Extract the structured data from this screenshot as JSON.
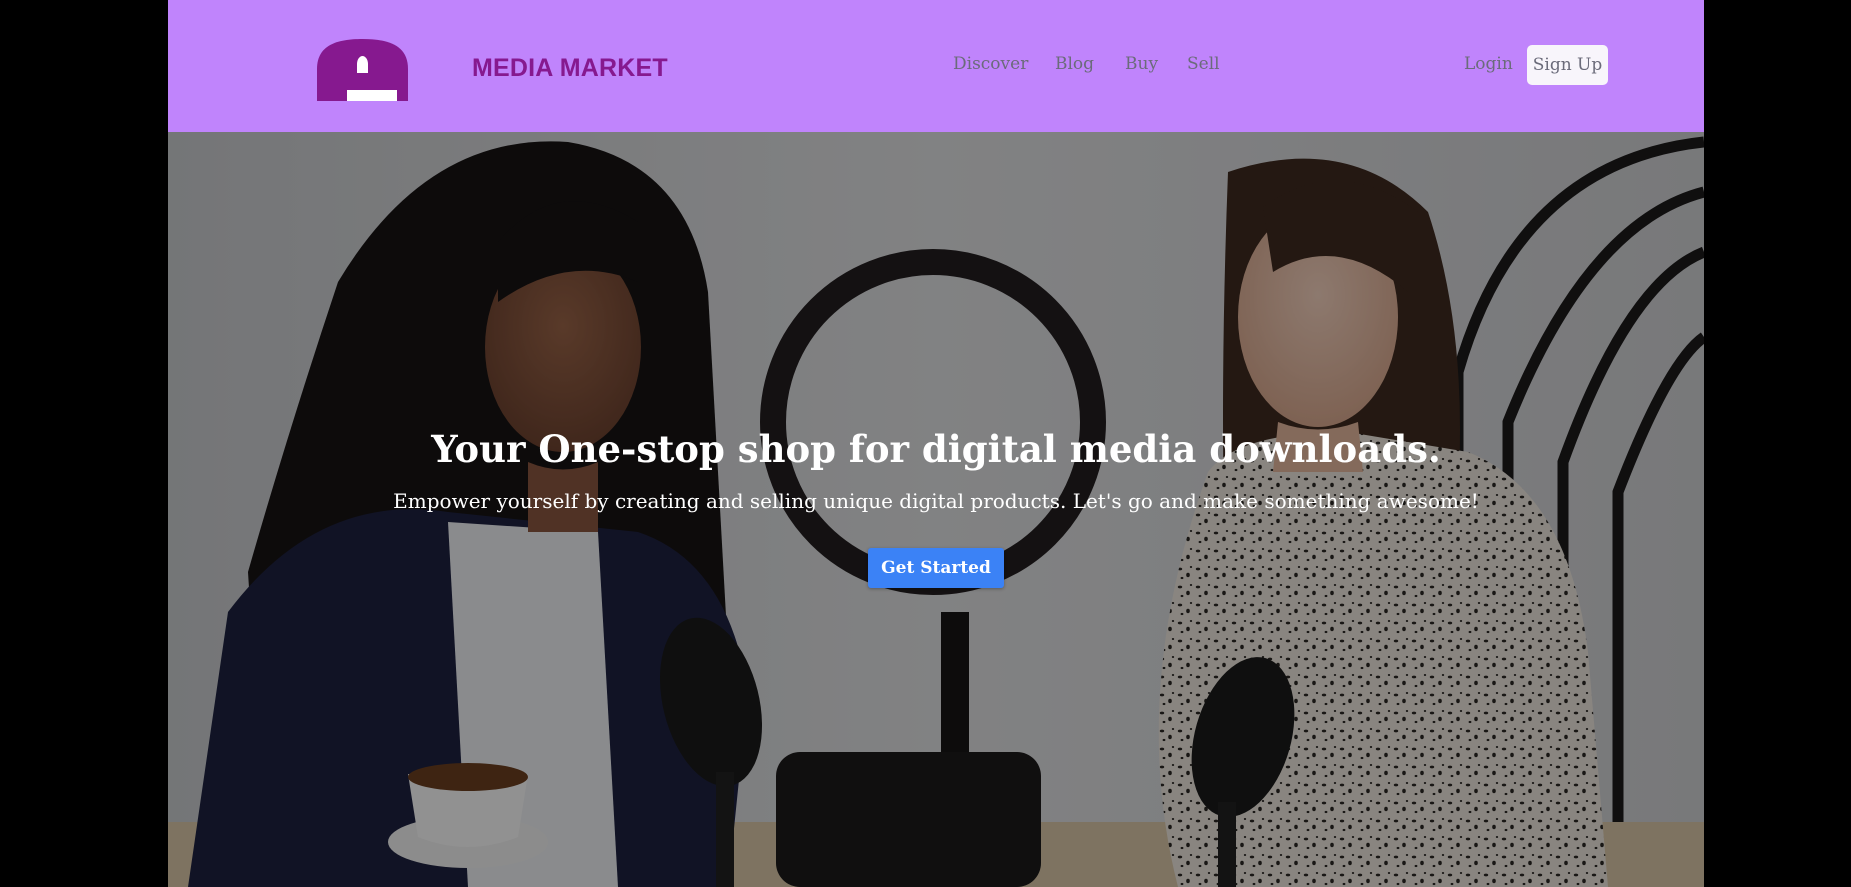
{
  "header": {
    "logo_icon": "media-market-logo-icon",
    "brand": "MEDIA MARKET",
    "nav": {
      "discover": "Discover",
      "blog": "Blog",
      "buy": "Buy",
      "sell": "Sell"
    },
    "login": "Login",
    "signup": "Sign Up"
  },
  "hero": {
    "title": "Your One-stop shop for digital media downloads.",
    "subtitle": "Empower yourself by creating and selling unique digital products. Let's go and make something awesome!",
    "cta": "Get Started"
  },
  "colors": {
    "navbar_bg": "#c084fc",
    "brand": "#86198f",
    "nav_link": "#6b6b7a",
    "cta_bg": "#3b82f6"
  }
}
